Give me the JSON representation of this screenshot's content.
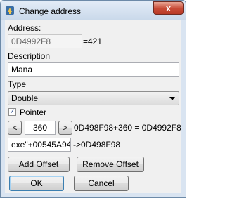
{
  "window": {
    "title": "Change address",
    "close_symbol": "x"
  },
  "address": {
    "label": "Address:",
    "value": "0D4992F8",
    "result": "=421"
  },
  "description": {
    "label": "Description",
    "value": "Mana"
  },
  "type": {
    "label": "Type",
    "selected": "Double"
  },
  "pointer": {
    "label": "Pointer",
    "checked": true,
    "check_symbol": "✓",
    "dec_label": "<",
    "offset": "360",
    "inc_label": ">",
    "offset_calc": "0D498F98+360 = 0D4992F8",
    "base": "exe\"+00545A94",
    "base_result": "->0D498F98"
  },
  "actions": {
    "add_offset": "Add Offset",
    "remove_offset": "Remove Offset",
    "ok": "OK",
    "cancel": "Cancel"
  },
  "icons": {
    "app_icon": "cheat-engine-icon",
    "close_icon": "close-icon"
  },
  "colors": {
    "titlebar": "#d9e4f1",
    "close_button": "#c74a36",
    "client": "#f0f0f0"
  }
}
